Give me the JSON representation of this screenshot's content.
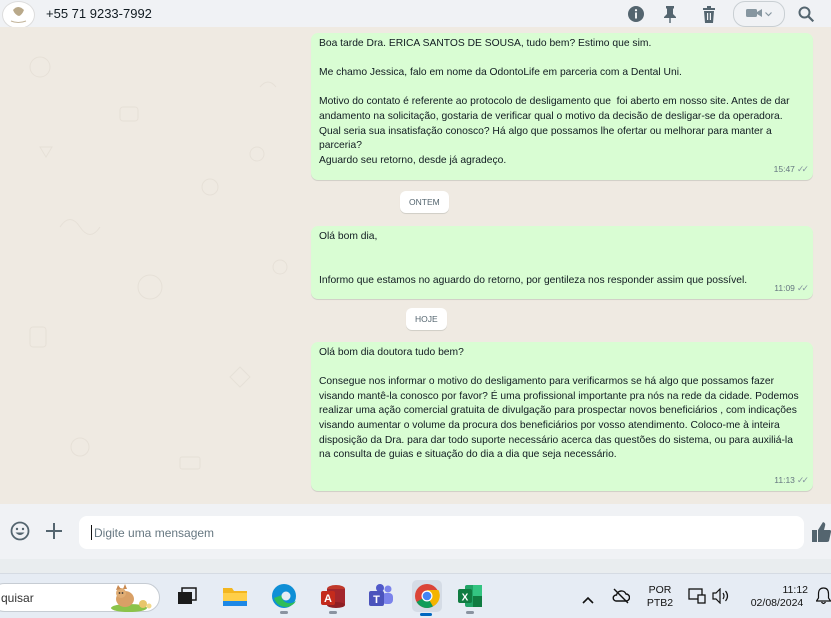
{
  "header": {
    "contact_name": "+55 71 9233-7992",
    "icons": [
      "info-icon",
      "pin-icon",
      "trash-icon",
      "video-icon",
      "search-icon"
    ]
  },
  "chat": {
    "messages": [
      {
        "text": "Boa tarde Dra. ERICA SANTOS DE SOUSA, tudo bem? Estimo que sim.\n\nMe chamo Jessica, falo em nome da OdontoLife em parceria com a Dental Uni.\n\nMotivo do contato é referente ao protocolo de desligamento que  foi aberto em nosso site. Antes de dar andamento na solicitação, gostaria de verificar qual o motivo da decisão de desligar-se da operadora. Qual seria sua insatisfação conosco? Há algo que possamos lhe ofertar ou melhorar para manter a parceria?\nAguardo seu retorno, desde já agradeço.",
        "time": "15:47"
      },
      {
        "text": "Olá bom dia,\n\n\nInformo que estamos no aguardo do retorno, por gentileza nos responder assim que possível.",
        "time": "11:09"
      },
      {
        "text": "Olá bom dia doutora tudo bem?\n\nConsegue nos informar o motivo do desligamento para verificarmos se há algo que possamos fazer visando mantê-la conosco por favor? É uma profissional importante pra nós na rede da cidade. Podemos realizar uma ação comercial gratuita de divulgação para prospectar novos beneficiários , com indicações visando aumentar o volume da procura dos beneficiários por vosso atendimento. Coloco-me à inteira disposição da Dra. para dar todo suporte necessário acerca das questões do sistema, ou para auxiliá-la na consulta de guias e situação do dia a dia que seja necessário.",
        "time": "11:13"
      }
    ],
    "day_labels": [
      "ONTEM",
      "HOJE"
    ],
    "tick_glyph": "✓✓"
  },
  "composer": {
    "placeholder": "Digite uma mensagem"
  },
  "taskbar": {
    "search_text": "quisar",
    "language": "POR",
    "layout": "PTB2",
    "time": "11:12",
    "date": "02/08/2024"
  },
  "colors": {
    "outgoing_bubble": "#d9fdd3",
    "chat_bg": "#efeae2",
    "header_bg": "#f0f2f5"
  }
}
